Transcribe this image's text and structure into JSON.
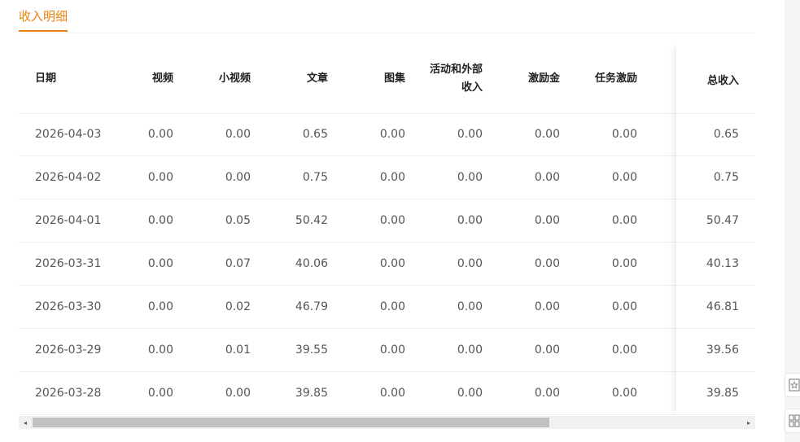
{
  "tab": {
    "label": "收入明细"
  },
  "table": {
    "headers": {
      "date": "日期",
      "video": "视频",
      "mini_video": "小视频",
      "article": "文章",
      "gallery": "图集",
      "activity_line1": "活动和外部",
      "activity_line2": "收入",
      "incentive": "激励金",
      "task_incentive": "任务激励",
      "total": "总收入"
    },
    "rows": [
      [
        "2026-04-03",
        "0.00",
        "0.00",
        "0.65",
        "0.00",
        "0.00",
        "0.00",
        "0.00",
        "0.65"
      ],
      [
        "2026-04-02",
        "0.00",
        "0.00",
        "0.75",
        "0.00",
        "0.00",
        "0.00",
        "0.00",
        "0.75"
      ],
      [
        "2026-04-01",
        "0.00",
        "0.05",
        "50.42",
        "0.00",
        "0.00",
        "0.00",
        "0.00",
        "50.47"
      ],
      [
        "2026-03-31",
        "0.00",
        "0.07",
        "40.06",
        "0.00",
        "0.00",
        "0.00",
        "0.00",
        "40.13"
      ],
      [
        "2026-03-30",
        "0.00",
        "0.02",
        "46.79",
        "0.00",
        "0.00",
        "0.00",
        "0.00",
        "46.81"
      ],
      [
        "2026-03-29",
        "0.00",
        "0.01",
        "39.55",
        "0.00",
        "0.00",
        "0.00",
        "0.00",
        "39.56"
      ],
      [
        "2026-03-28",
        "0.00",
        "0.00",
        "39.85",
        "0.00",
        "0.00",
        "0.00",
        "0.00",
        "39.85"
      ]
    ]
  },
  "scrollbar": {
    "left_arrow": "◂",
    "right_arrow": "▸",
    "position_fraction": 0.0,
    "visible_fraction": 0.72
  },
  "right_rail": {
    "icons": [
      "star-doc-icon",
      "grid-icon"
    ]
  },
  "colors": {
    "accent": "#e8820c",
    "border": "#eeeeee",
    "text": "#555555"
  }
}
